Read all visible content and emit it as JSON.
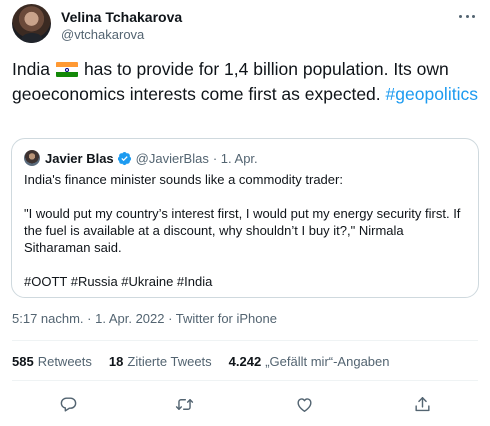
{
  "author": {
    "name": "Velina Tchakarova",
    "handle": "@vtchakarova"
  },
  "tweet": {
    "text_part1": "India",
    "text_part2": "has to provide for 1,4 billion population. Its own geoeconomics interests come first as expected.",
    "hashtag": "#geopolitics"
  },
  "quoted": {
    "name": "Javier Blas",
    "handle": "@JavierBlas",
    "date": "· 1. Apr.",
    "paragraphs": [
      "India's finance minister sounds like a commodity trader:",
      "\"I would put my country’s interest first, I would put my energy security first. If the fuel is available at a discount, why shouldn’t I buy it?,\" Nirmala Sitharaman said.",
      "#OOTT #Russia #Ukraine #India"
    ]
  },
  "meta": {
    "text": "5:17 nachm. · 1. Apr. 2022 · Twitter for iPhone"
  },
  "stats": {
    "retweets": {
      "count": "585",
      "label": "Retweets"
    },
    "quotes": {
      "count": "18",
      "label": "Zitierte Tweets"
    },
    "likes": {
      "count": "4.242",
      "label": "„Gefällt mir“-Angaben"
    }
  },
  "icons": {
    "more": "more-dots-icon",
    "flag": "india-flag-icon",
    "verified": "verified-badge-icon",
    "reply": "reply-icon",
    "retweet": "retweet-icon",
    "like": "like-icon",
    "share": "share-icon"
  },
  "colors": {
    "link": "#1d9bf0",
    "muted": "#536471",
    "text": "#0f1419",
    "border": "#cfd9de"
  }
}
